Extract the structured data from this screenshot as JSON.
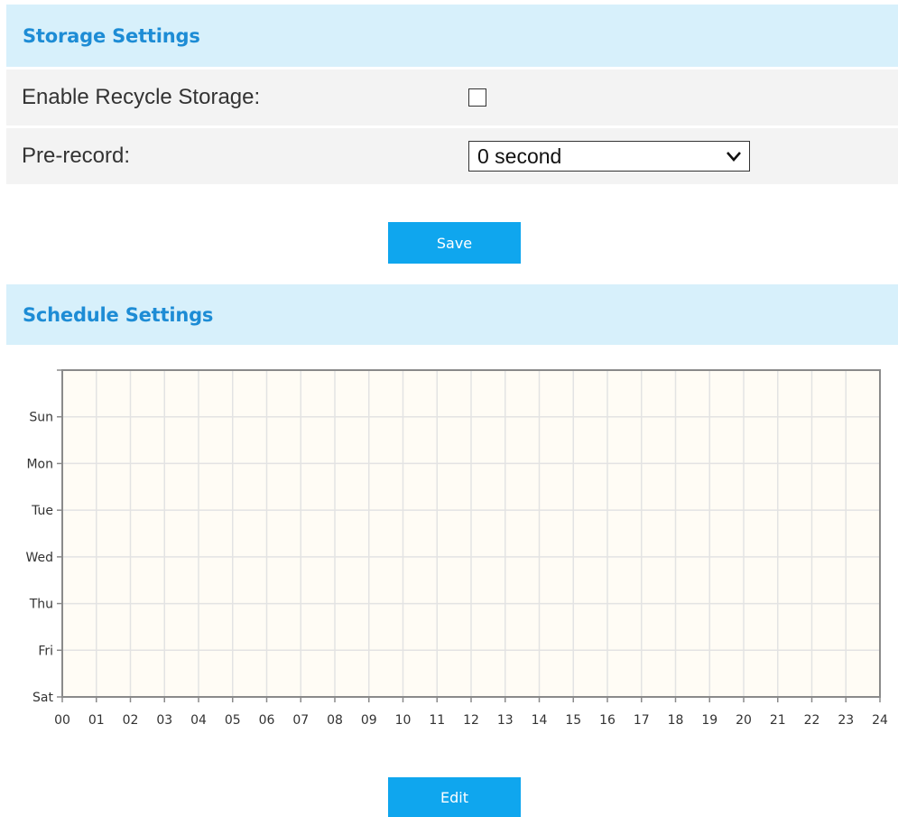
{
  "storage": {
    "title": "Storage Settings",
    "recycle_label": "Enable Recycle Storage:",
    "recycle_checked": false,
    "prerecord_label": "Pre-record:",
    "prerecord_value": "0 second",
    "save_label": "Save"
  },
  "schedule": {
    "title": "Schedule Settings",
    "days": [
      "Sun",
      "Mon",
      "Tue",
      "Wed",
      "Thu",
      "Fri",
      "Sat"
    ],
    "hours": [
      "00",
      "01",
      "02",
      "03",
      "04",
      "05",
      "06",
      "07",
      "08",
      "09",
      "10",
      "11",
      "12",
      "13",
      "14",
      "15",
      "16",
      "17",
      "18",
      "19",
      "20",
      "21",
      "22",
      "23",
      "24"
    ],
    "scheduled_blocks": [],
    "edit_label": "Edit"
  },
  "colors": {
    "accent": "#0fa6ee",
    "header_bg": "#d7f0fb",
    "header_text": "#1d8cd5",
    "row_bg": "#f3f3f3",
    "chart_bg": "#fffcf5"
  }
}
